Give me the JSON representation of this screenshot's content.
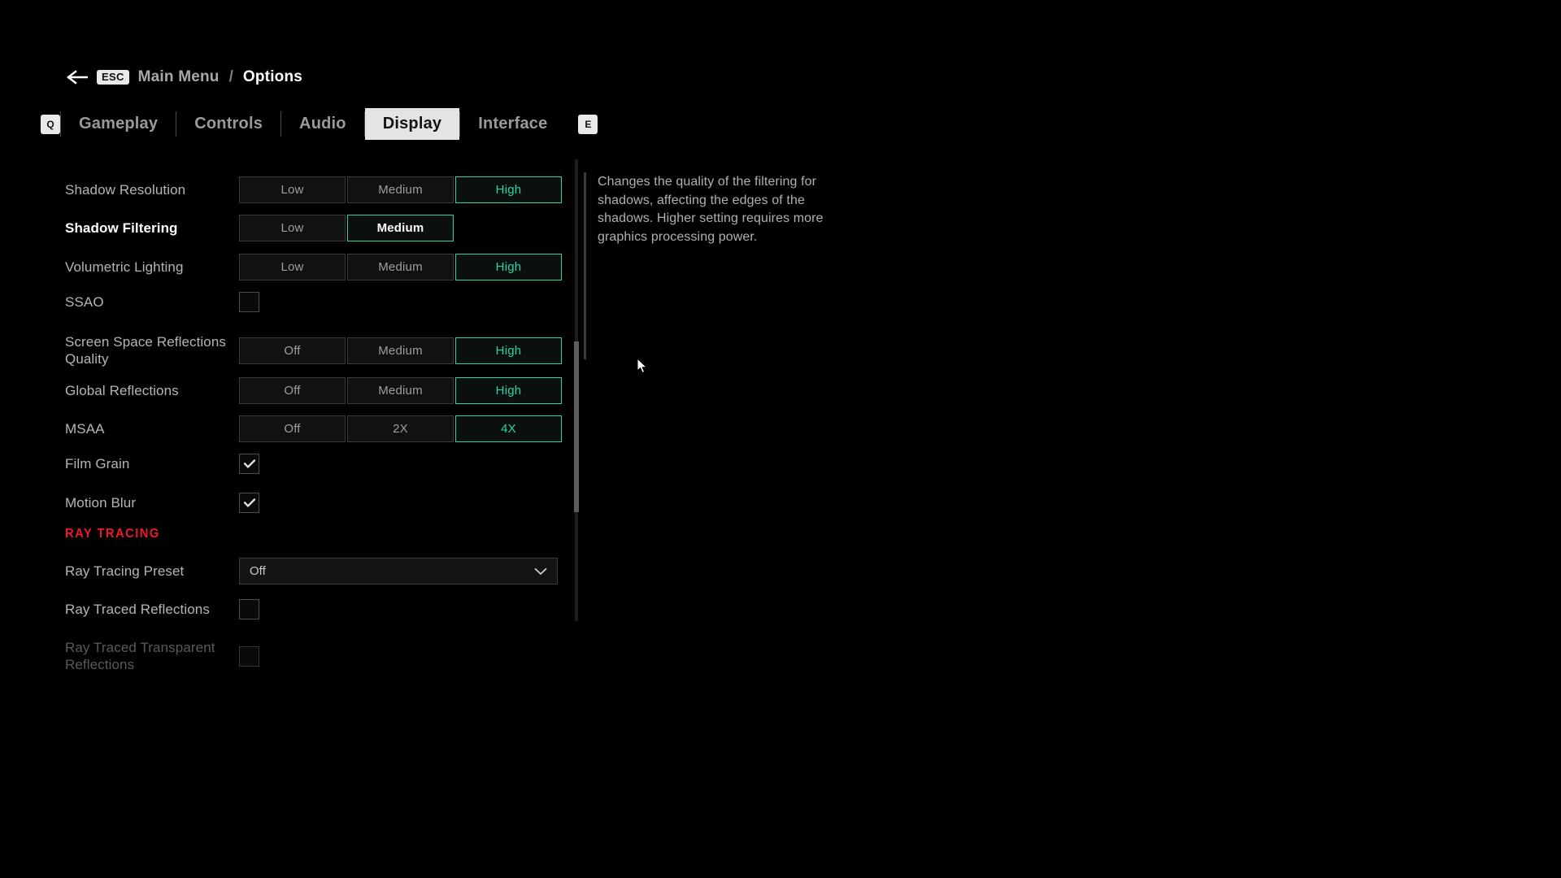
{
  "breadcrumb": {
    "back_icon": "arrow-left-icon",
    "esc_key": "ESC",
    "parent": "Main Menu",
    "separator": "/",
    "current": "Options"
  },
  "tabs": {
    "prev_key": "Q",
    "next_key": "E",
    "items": [
      {
        "label": "Gameplay",
        "active": false
      },
      {
        "label": "Controls",
        "active": false
      },
      {
        "label": "Audio",
        "active": false
      },
      {
        "label": "Display",
        "active": true
      },
      {
        "label": "Interface",
        "active": false
      }
    ]
  },
  "settings": [
    {
      "id": "shadow-resolution",
      "label": "Shadow Resolution",
      "type": "segmented",
      "options": [
        "Low",
        "Medium",
        "High"
      ],
      "selected": 2,
      "focused": false,
      "disabled": false
    },
    {
      "id": "shadow-filtering",
      "label": "Shadow Filtering",
      "type": "segmented",
      "options": [
        "Low",
        "Medium"
      ],
      "selected": 1,
      "focused": true,
      "disabled": false
    },
    {
      "id": "volumetric-lighting",
      "label": "Volumetric Lighting",
      "type": "segmented",
      "options": [
        "Low",
        "Medium",
        "High"
      ],
      "selected": 2,
      "focused": false,
      "disabled": false
    },
    {
      "id": "ssao",
      "label": "SSAO",
      "type": "checkbox",
      "checked": false,
      "focused": false,
      "disabled": false
    },
    {
      "id": "screen-space-reflections-quality",
      "label": "Screen Space Reflections Quality",
      "type": "segmented",
      "options": [
        "Off",
        "Medium",
        "High"
      ],
      "selected": 2,
      "focused": false,
      "disabled": false
    },
    {
      "id": "global-reflections",
      "label": "Global Reflections",
      "type": "segmented",
      "options": [
        "Off",
        "Medium",
        "High"
      ],
      "selected": 2,
      "focused": false,
      "disabled": false
    },
    {
      "id": "msaa",
      "label": "MSAA",
      "type": "segmented",
      "options": [
        "Off",
        "2X",
        "4X"
      ],
      "selected": 2,
      "focused": false,
      "disabled": false
    },
    {
      "id": "film-grain",
      "label": "Film Grain",
      "type": "checkbox",
      "checked": true,
      "focused": false,
      "disabled": false
    },
    {
      "id": "motion-blur",
      "label": "Motion Blur",
      "type": "checkbox",
      "checked": true,
      "focused": false,
      "disabled": false
    },
    {
      "id": "ray-tracing-section",
      "label": "RAY TRACING",
      "type": "section",
      "color": "#ee1a24"
    },
    {
      "id": "ray-tracing-preset",
      "label": "Ray Tracing Preset",
      "type": "dropdown",
      "value": "Off",
      "focused": false,
      "disabled": false
    },
    {
      "id": "ray-traced-reflections",
      "label": "Ray Traced Reflections",
      "type": "checkbox",
      "checked": false,
      "focused": false,
      "disabled": false
    },
    {
      "id": "ray-traced-transparent-reflections",
      "label": "Ray Traced Transparent Reflections",
      "type": "checkbox",
      "checked": false,
      "focused": false,
      "disabled": true
    }
  ],
  "description": {
    "text": "Changes the quality of the filtering for shadows, affecting the edges of the shadows. Higher setting requires more graphics processing power."
  },
  "colors": {
    "accent_teal": "#2ad4a8",
    "section_red": "#ee1a24",
    "active_tab_bg": "#e4e4e2",
    "background": "#000000"
  }
}
